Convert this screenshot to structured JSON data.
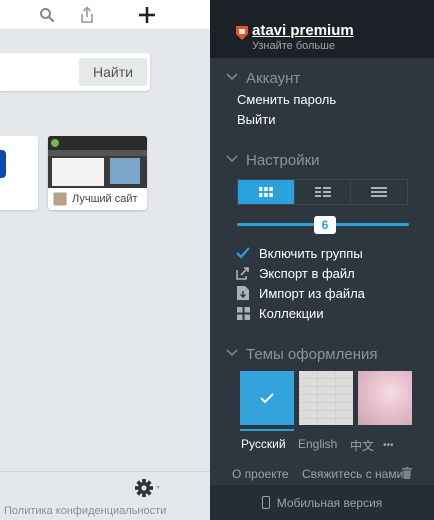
{
  "colors": {
    "accent": "#2aa0dc",
    "panel_bg": "#2e3640",
    "panel_top_bg": "#1c2128",
    "left_bg": "#e4e8ea",
    "premium_orange": "#e5532d"
  },
  "toolbar": {
    "search_icon": "search-icon",
    "share_icon": "share-icon",
    "add_icon": "plus-icon"
  },
  "search": {
    "value": "",
    "button_label": "Найти"
  },
  "bookmark": {
    "title": "Лучший сайт"
  },
  "left_footer": {
    "privacy_link": "Политика конфиденциальности",
    "settings_icon": "gear-icon"
  },
  "premium": {
    "title": "atavi premium",
    "subtitle": "Узнайте больше"
  },
  "account": {
    "heading": "Аккаунт",
    "change_password": "Сменить пароль",
    "logout": "Выйти"
  },
  "settings": {
    "heading": "Настройки",
    "view_modes": [
      "grid-view",
      "list-view",
      "rows-view"
    ],
    "active_view": "grid-view",
    "columns_value": "6",
    "options": [
      {
        "label": "Включить группы",
        "icon": "check-icon"
      },
      {
        "label": "Экспорт в файл",
        "icon": "export-icon"
      },
      {
        "label": "Импорт из файла",
        "icon": "import-icon"
      },
      {
        "label": "Коллекции",
        "icon": "collections-icon"
      }
    ]
  },
  "themes": {
    "heading": "Темы оформления",
    "selected": "blue"
  },
  "languages": {
    "items": [
      "Русский",
      "English",
      "中文"
    ],
    "active": "Русский",
    "more": "•••"
  },
  "footer": {
    "about": "О проекте",
    "contact": "Свяжитесь с нами",
    "mobile": "Мобильная версия"
  }
}
